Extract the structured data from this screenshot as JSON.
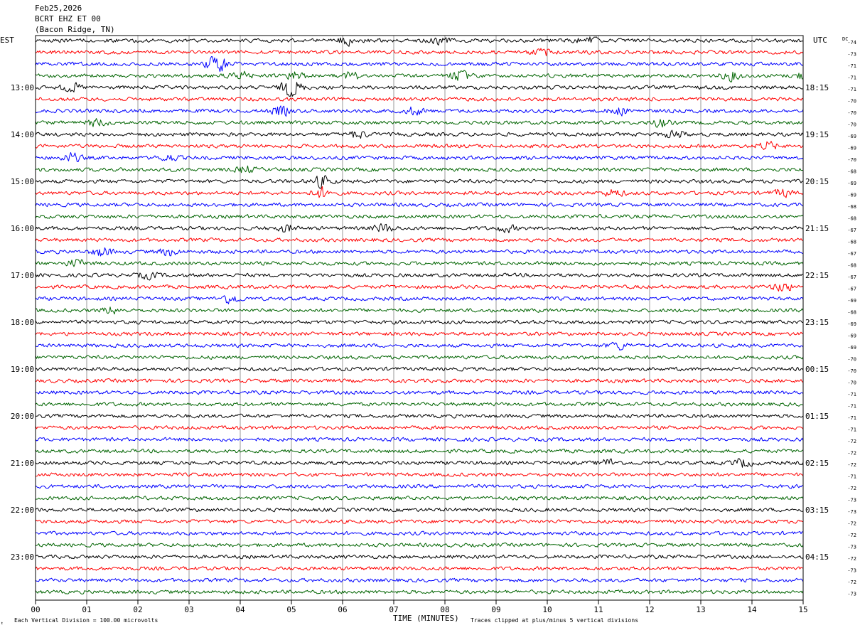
{
  "header": {
    "date": "Feb25,2026",
    "station": "BCRT EHZ ET 00",
    "location": "(Bacon Ridge, TN)",
    "left_timezone": "EST",
    "right_timezone": "UTC",
    "dc_label": "DC"
  },
  "footer": {
    "scale_note": "Each Vertical Division =  100.00 microvolts",
    "axis_title": "TIME (MINUTES)",
    "clip_note": "Traces clipped at plus/minus 5 vertical divisions"
  },
  "colors": {
    "cycle": [
      "#000000",
      "#ff0000",
      "#0000ff",
      "#006400"
    ],
    "grid": "#808080",
    "frame": "#000000"
  },
  "chart_data": {
    "type": "line",
    "subtype": "helicorder",
    "x_unit": "minutes",
    "xlim": [
      0,
      15
    ],
    "x_ticks": [
      "00",
      "01",
      "02",
      "03",
      "04",
      "05",
      "06",
      "07",
      "08",
      "09",
      "10",
      "11",
      "12",
      "13",
      "14",
      "15"
    ],
    "minutes_per_line": 15,
    "line_count": 48,
    "line_start_local": "12:00",
    "hour_labels_left": [
      "13:00",
      "14:00",
      "15:00",
      "16:00",
      "17:00",
      "18:00",
      "19:00",
      "20:00",
      "21:00",
      "22:00",
      "23:00"
    ],
    "hour_labels_right": [
      "18:15",
      "19:15",
      "20:15",
      "21:15",
      "22:15",
      "23:15",
      "00:15",
      "01:15",
      "02:15",
      "03:15",
      "04:15"
    ],
    "dc_offsets": [
      -74,
      -73,
      -71,
      -71,
      -71,
      -70,
      -70,
      -70,
      -69,
      -69,
      -70,
      -68,
      -69,
      -69,
      -68,
      -68,
      -67,
      -68,
      -67,
      -68,
      -67,
      -67,
      -69,
      -68,
      -69,
      -69,
      -69,
      -70,
      -70,
      -70,
      -71,
      -71,
      -71,
      -71,
      -72,
      -72,
      -72,
      -71,
      -72,
      -73,
      -73,
      -72,
      -72,
      -73,
      -72,
      -73,
      -72,
      -73
    ],
    "amplitude_noise_px": 2.6,
    "bursts": [
      {
        "line": 0,
        "minute": 6.1,
        "amp": 2.0
      },
      {
        "line": 0,
        "minute": 7.9,
        "amp": 1.6
      },
      {
        "line": 0,
        "minute": 10.8,
        "amp": 2.2
      },
      {
        "line": 1,
        "minute": 9.9,
        "amp": 2.0
      },
      {
        "line": 2,
        "minute": 3.5,
        "amp": 2.6
      },
      {
        "line": 2,
        "minute": 3.6,
        "amp": 2.0
      },
      {
        "line": 3,
        "minute": 4.0,
        "amp": 2.0
      },
      {
        "line": 3,
        "minute": 5.1,
        "amp": 2.2
      },
      {
        "line": 3,
        "minute": 6.2,
        "amp": 1.8
      },
      {
        "line": 3,
        "minute": 8.3,
        "amp": 2.6
      },
      {
        "line": 3,
        "minute": 13.6,
        "amp": 2.2
      },
      {
        "line": 3,
        "minute": 15.0,
        "amp": 1.8
      },
      {
        "line": 4,
        "minute": 0.7,
        "amp": 2.0
      },
      {
        "line": 4,
        "minute": 5.0,
        "amp": 5.0
      },
      {
        "line": 6,
        "minute": 4.8,
        "amp": 2.4
      },
      {
        "line": 6,
        "minute": 7.4,
        "amp": 1.8
      },
      {
        "line": 6,
        "minute": 11.4,
        "amp": 1.8
      },
      {
        "line": 7,
        "minute": 1.2,
        "amp": 1.8
      },
      {
        "line": 7,
        "minute": 12.2,
        "amp": 1.8
      },
      {
        "line": 8,
        "minute": 6.3,
        "amp": 1.8
      },
      {
        "line": 8,
        "minute": 12.5,
        "amp": 2.0
      },
      {
        "line": 9,
        "minute": 14.3,
        "amp": 2.0
      },
      {
        "line": 10,
        "minute": 0.7,
        "amp": 2.2
      },
      {
        "line": 10,
        "minute": 2.6,
        "amp": 1.6
      },
      {
        "line": 11,
        "minute": 4.1,
        "amp": 1.6
      },
      {
        "line": 12,
        "minute": 5.6,
        "amp": 2.8
      },
      {
        "line": 13,
        "minute": 5.6,
        "amp": 2.6
      },
      {
        "line": 13,
        "minute": 11.3,
        "amp": 1.8
      },
      {
        "line": 13,
        "minute": 14.6,
        "amp": 1.8
      },
      {
        "line": 16,
        "minute": 4.9,
        "amp": 1.6
      },
      {
        "line": 16,
        "minute": 6.8,
        "amp": 2.0
      },
      {
        "line": 16,
        "minute": 9.2,
        "amp": 1.6
      },
      {
        "line": 18,
        "minute": 1.3,
        "amp": 2.2
      },
      {
        "line": 18,
        "minute": 2.6,
        "amp": 1.8
      },
      {
        "line": 19,
        "minute": 0.8,
        "amp": 1.8
      },
      {
        "line": 20,
        "minute": 2.2,
        "amp": 1.6
      },
      {
        "line": 21,
        "minute": 14.6,
        "amp": 2.2
      },
      {
        "line": 22,
        "minute": 3.8,
        "amp": 2.4
      },
      {
        "line": 23,
        "minute": 1.5,
        "amp": 1.6
      },
      {
        "line": 26,
        "minute": 11.4,
        "amp": 1.8
      },
      {
        "line": 36,
        "minute": 11.2,
        "amp": 1.8
      },
      {
        "line": 36,
        "minute": 13.8,
        "amp": 2.0
      }
    ]
  }
}
